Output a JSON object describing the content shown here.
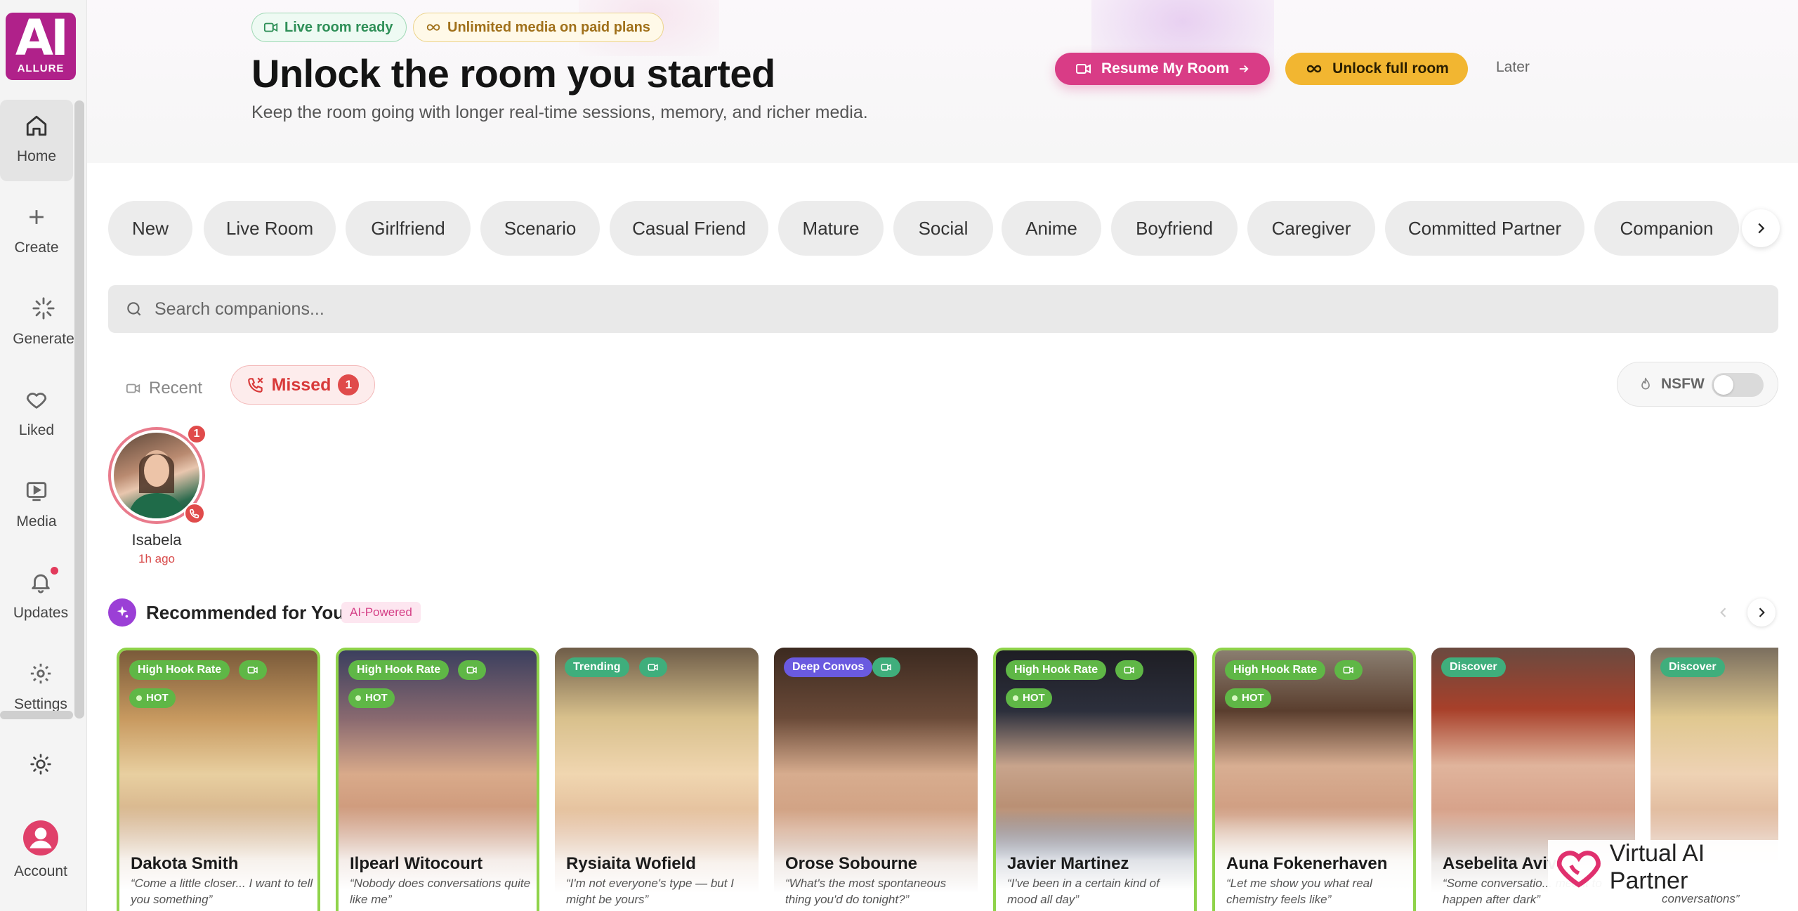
{
  "brand": {
    "logo_text": "AI",
    "logo_sub": "ALLURE"
  },
  "sidebar": {
    "items": [
      {
        "label": "Home",
        "icon": "home-icon"
      },
      {
        "label": "Create",
        "icon": "plus-icon"
      },
      {
        "label": "Generate",
        "icon": "sparkle-icon"
      },
      {
        "label": "Liked",
        "icon": "heart-icon"
      },
      {
        "label": "Media",
        "icon": "play-icon"
      },
      {
        "label": "Updates",
        "icon": "bell-icon"
      },
      {
        "label": "Settings",
        "icon": "gear-icon"
      },
      {
        "label": "",
        "icon": "sun-icon"
      },
      {
        "label": "Account",
        "icon": "avatar-icon"
      }
    ]
  },
  "header": {
    "badge_live": "Live room ready",
    "badge_media": "Unlimited media on paid plans",
    "title": "Unlock the room you started",
    "subtitle": "Keep the room going with longer real-time sessions, memory, and richer media.",
    "resume_label": "Resume My Room",
    "unlock_label": "Unlock full room",
    "later_label": "Later"
  },
  "categories": [
    "New",
    "Live Room",
    "Girlfriend",
    "Scenario",
    "Casual Friend",
    "Mature",
    "Social",
    "Anime",
    "Boyfriend",
    "Caregiver",
    "Committed Partner",
    "Companion"
  ],
  "search": {
    "placeholder": "Search companions..."
  },
  "tabs": {
    "recent": "Recent",
    "missed": "Missed",
    "missed_count": "1"
  },
  "nsfw": {
    "label": "NSFW",
    "enabled": false
  },
  "missed_calls": [
    {
      "name": "Isabela",
      "time": "1h ago",
      "badge": "1"
    }
  ],
  "recommended": {
    "title": "Recommended for You",
    "badge": "AI-Powered",
    "cards": [
      {
        "name": "Dakota Smith",
        "quote": "“Come a little closer... I want to tell you something”",
        "tag": "High Hook Rate",
        "hot": "HOT"
      },
      {
        "name": "Ilpearl Witocourt",
        "quote": "“Nobody does conversations quite like me”",
        "tag": "High Hook Rate",
        "hot": "HOT"
      },
      {
        "name": "Rysiaita Wofield",
        "quote": "“I'm not everyone's type — but I might be yours”",
        "tag": "Trending",
        "hot": ""
      },
      {
        "name": "Orose Sobourne",
        "quote": "“What's the most spontaneous thing you'd do tonight?”",
        "tag": "Deep Convos",
        "hot": ""
      },
      {
        "name": "Javier Martinez",
        "quote": "“I've been in a certain kind of mood all day”",
        "tag": "High Hook Rate",
        "hot": "HOT"
      },
      {
        "name": "Auna Fokenerhaven",
        "quote": "“Let me show you what real chemistry feels like”",
        "tag": "High Hook Rate",
        "hot": "HOT"
      },
      {
        "name": "Asebelita Aviv",
        "quote": "“Some conversatio... meant to happen after dark”",
        "tag": "Discover",
        "hot": ""
      },
      {
        "name": "",
        "quote": "conversations”",
        "tag": "Discover",
        "hot": ""
      }
    ]
  },
  "watermark": {
    "text": "Virtual AI Partner"
  },
  "colors": {
    "accent_pink": "#d93c86",
    "accent_gold": "#f2b631",
    "hook_green": "#8fd34a",
    "missed_red": "#e04b4b"
  }
}
